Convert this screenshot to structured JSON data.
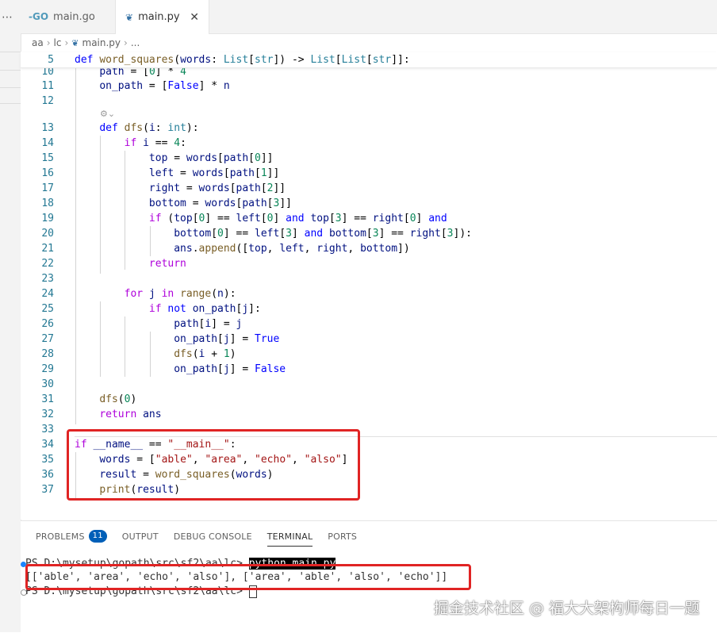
{
  "tabs": [
    {
      "label": "main.go",
      "icon": "go-file-icon"
    },
    {
      "label": "main.py",
      "icon": "python-file-icon",
      "active": true
    }
  ],
  "breadcrumb": [
    "aa",
    "lc",
    "main.py",
    "..."
  ],
  "editor": {
    "lines": [
      {
        "n": "5",
        "html": "<span class='kw'>def</span> <span class='fn'>word_squares</span>(<span class='var'>words</span>: <span class='ty'>List</span>[<span class='ty'>str</span>]) -> <span class='ty'>List</span>[<span class='ty'>List</span>[<span class='ty'>str</span>]]:"
      },
      {
        "n": "10",
        "html": "    <span class='var'>path</span> = [<span class='num'>0</span>] * <span class='num'>4</span>"
      },
      {
        "n": "11",
        "html": "    <span class='var'>on_path</span> = [<span class='kw'>False</span>] * <span class='var'>n</span>"
      },
      {
        "n": "12",
        "html": ""
      },
      {
        "n": "13",
        "html": "    <span class='kw'>def</span> <span class='fn'>dfs</span>(<span class='var'>i</span>: <span class='ty'>int</span>):"
      },
      {
        "n": "14",
        "html": "        <span class='ctl'>if</span> <span class='var'>i</span> == <span class='num'>4</span>:"
      },
      {
        "n": "15",
        "html": "            <span class='var'>top</span> = <span class='var'>words</span>[<span class='var'>path</span>[<span class='num'>0</span>]]"
      },
      {
        "n": "16",
        "html": "            <span class='var'>left</span> = <span class='var'>words</span>[<span class='var'>path</span>[<span class='num'>1</span>]]"
      },
      {
        "n": "17",
        "html": "            <span class='var'>right</span> = <span class='var'>words</span>[<span class='var'>path</span>[<span class='num'>2</span>]]"
      },
      {
        "n": "18",
        "html": "            <span class='var'>bottom</span> = <span class='var'>words</span>[<span class='var'>path</span>[<span class='num'>3</span>]]"
      },
      {
        "n": "19",
        "html": "            <span class='ctl'>if</span> (<span class='var'>top</span>[<span class='num'>0</span>] == <span class='var'>left</span>[<span class='num'>0</span>] <span class='kw'>and</span> <span class='var'>top</span>[<span class='num'>3</span>] == <span class='var'>right</span>[<span class='num'>0</span>] <span class='kw'>and</span>"
      },
      {
        "n": "20",
        "html": "                <span class='var'>bottom</span>[<span class='num'>0</span>] == <span class='var'>left</span>[<span class='num'>3</span>] <span class='kw'>and</span> <span class='var'>bottom</span>[<span class='num'>3</span>] == <span class='var'>right</span>[<span class='num'>3</span>]):"
      },
      {
        "n": "21",
        "html": "                <span class='var'>ans</span>.<span class='fn'>append</span>([<span class='var'>top</span>, <span class='var'>left</span>, <span class='var'>right</span>, <span class='var'>bottom</span>])"
      },
      {
        "n": "22",
        "html": "            <span class='ctl'>return</span>"
      },
      {
        "n": "23",
        "html": ""
      },
      {
        "n": "24",
        "html": "        <span class='ctl'>for</span> <span class='var'>j</span> <span class='ctl'>in</span> <span class='fn'>range</span>(<span class='var'>n</span>):"
      },
      {
        "n": "25",
        "html": "            <span class='ctl'>if</span> <span class='kw'>not</span> <span class='var'>on_path</span>[<span class='var'>j</span>]:"
      },
      {
        "n": "26",
        "html": "                <span class='var'>path</span>[<span class='var'>i</span>] = <span class='var'>j</span>"
      },
      {
        "n": "27",
        "html": "                <span class='var'>on_path</span>[<span class='var'>j</span>] = <span class='kw'>True</span>"
      },
      {
        "n": "28",
        "html": "                <span class='fn'>dfs</span>(<span class='var'>i</span> + <span class='num'>1</span>)"
      },
      {
        "n": "29",
        "html": "                <span class='var'>on_path</span>[<span class='var'>j</span>] = <span class='kw'>False</span>"
      },
      {
        "n": "30",
        "html": ""
      },
      {
        "n": "31",
        "html": "    <span class='fn'>dfs</span>(<span class='num'>0</span>)"
      },
      {
        "n": "32",
        "html": "    <span class='ctl'>return</span> <span class='var'>ans</span>"
      },
      {
        "n": "33",
        "html": ""
      },
      {
        "n": "34",
        "html": "<span class='ctl'>if</span> <span class='var'>__name__</span> == <span class='str'>\"__main__\"</span>:"
      },
      {
        "n": "35",
        "html": "    <span class='var'>words</span> = [<span class='str'>\"able\"</span>, <span class='str'>\"area\"</span>, <span class='str'>\"echo\"</span>, <span class='str'>\"also\"</span>]"
      },
      {
        "n": "36",
        "html": "    <span class='var'>result</span> = <span class='fn'>word_squares</span>(<span class='var'>words</span>)"
      },
      {
        "n": "37",
        "html": "    <span class='fn'>print</span>(<span class='var'>result</span>)"
      }
    ]
  },
  "panel": {
    "tabs": [
      {
        "label": "PROBLEMS",
        "badge": "11"
      },
      {
        "label": "OUTPUT"
      },
      {
        "label": "DEBUG CONSOLE"
      },
      {
        "label": "TERMINAL",
        "active": true
      },
      {
        "label": "PORTS"
      }
    ],
    "terminal": {
      "prompt1": "PS D:\\mysetup\\gopath\\src\\sf2\\aa\\lc> ",
      "command": "python main.py",
      "output": "[['able', 'area', 'echo', 'also'], ['area', 'able', 'also', 'echo']]",
      "prompt2": "PS D:\\mysetup\\gopath\\src\\sf2\\aa\\lc> "
    }
  },
  "watermark": "掘金技术社区 @ 福大大架构师每日一题",
  "colors": {
    "highlight_box": "#e02424",
    "badge": "#005fb8",
    "dot_blue": "#1a85ff"
  }
}
